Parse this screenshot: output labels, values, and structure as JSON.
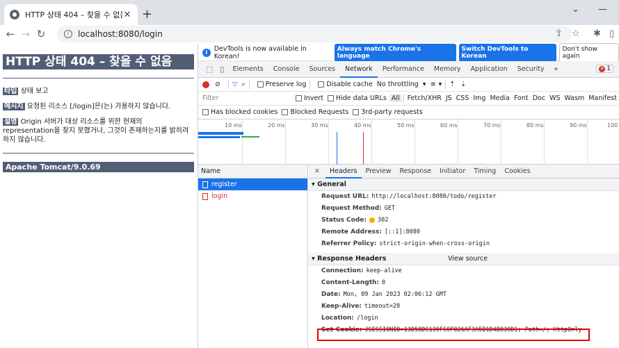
{
  "browser": {
    "tab_title": "HTTP 상태 404 – 찾을 수 없음",
    "url": "localhost:8080/login"
  },
  "page": {
    "heading": "HTTP 상태 404 – 찾을 수 없음",
    "type_label": "타입",
    "type_value": "상태 보고",
    "message_label": "메시지",
    "message_value": "요청된 리소스 [/login]은(는) 가용하지 않습니다.",
    "desc_label": "설명",
    "desc_value": "Origin 서버가 대상 리소스를 위한 현재의 representation을 찾지 못했거나, 그것이 존재하는지를 밝히려 하지 않습니다.",
    "footer": "Apache Tomcat/9.0.69"
  },
  "devtools": {
    "infobar": {
      "message": "DevTools is now available in Korean!",
      "btn_match": "Always match Chrome's language",
      "btn_switch": "Switch DevTools to Korean",
      "btn_dismiss": "Don't show again"
    },
    "tabs": [
      "Elements",
      "Console",
      "Sources",
      "Network",
      "Performance",
      "Memory",
      "Application",
      "Security",
      "»"
    ],
    "error_count": "1",
    "network_bar": {
      "preserve_log": "Preserve log",
      "disable_cache": "Disable cache",
      "throttling": "No throttling"
    },
    "filter_bar": {
      "placeholder": "Filter",
      "invert": "Invert",
      "hide_data_urls": "Hide data URLs",
      "types": [
        "All",
        "Fetch/XHR",
        "JS",
        "CSS",
        "Img",
        "Media",
        "Font",
        "Doc",
        "WS",
        "Wasm",
        "Manifest"
      ]
    },
    "blocked_bar": {
      "has_blocked_cookies": "Has blocked cookies",
      "blocked_requests": "Blocked Requests",
      "third_party": "3rd-party requests"
    },
    "timeline_ticks": [
      "10 ms",
      "20 ms",
      "30 ms",
      "40 ms",
      "50 ms",
      "60 ms",
      "70 ms",
      "80 ms",
      "90 ms",
      "100"
    ],
    "list": {
      "header": "Name",
      "rows": [
        "register",
        "login"
      ]
    },
    "detail": {
      "tabs": [
        "Headers",
        "Preview",
        "Response",
        "Initiator",
        "Timing",
        "Cookies"
      ],
      "general_title": "General",
      "general": [
        {
          "k": "Request URL:",
          "v": "http://localhost:8080/todo/register"
        },
        {
          "k": "Request Method:",
          "v": "GET"
        },
        {
          "k": "Status Code:",
          "v": "302"
        },
        {
          "k": "Remote Address:",
          "v": "[::1]:8080"
        },
        {
          "k": "Referrer Policy:",
          "v": "strict-origin-when-cross-origin"
        }
      ],
      "response_title": "Response Headers",
      "view_source": "View source",
      "response": [
        {
          "k": "Connection:",
          "v": "keep-alive"
        },
        {
          "k": "Content-Length:",
          "v": "0"
        },
        {
          "k": "Date:",
          "v": "Mon, 09 Jan 2023 02:06:12 GMT"
        },
        {
          "k": "Keep-Alive:",
          "v": "timeout=20"
        },
        {
          "k": "Location:",
          "v": "/login"
        },
        {
          "k": "Set-Cookie:",
          "v": "JSESSIONID=13D58DC130FC0F826AF3A5B1D4B830D1; Path=/; HttpOnly"
        }
      ]
    }
  }
}
